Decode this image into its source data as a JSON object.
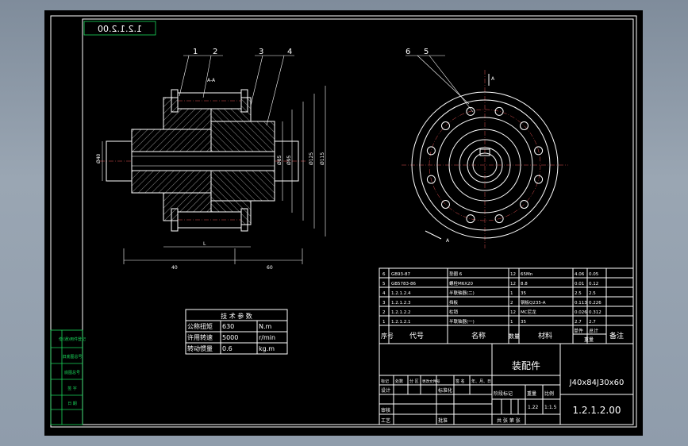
{
  "drawing_code_box": "1.2.1.2.00",
  "balloons": [
    "1",
    "2",
    "3",
    "4",
    "6",
    "5"
  ],
  "section_mark": "A-A",
  "side_view_mark": "A",
  "left_dims": [
    "Ø40",
    "40",
    "60",
    "L"
  ],
  "right_dims": [
    "Ø85",
    "Ø95",
    "Ø125",
    "Ø115"
  ],
  "tech_table": {
    "title": "技 术 参 数",
    "rows": [
      {
        "name": "公称扭矩",
        "value": "630",
        "unit": "N.m"
      },
      {
        "name": "许用转速",
        "value": "5000",
        "unit": "r/min"
      },
      {
        "name": "转动惯量",
        "value": "0.6",
        "unit": "kg.m"
      }
    ]
  },
  "bom": {
    "rows": [
      {
        "no": "6",
        "code": "GB93-87",
        "name": "垫圈 6",
        "qty": "12",
        "mat": "65Mn",
        "w1": "4.06",
        "w2": "0.05"
      },
      {
        "no": "5",
        "code": "GB5783-86",
        "name": "螺栓M6X20",
        "qty": "12",
        "mat": "8.8",
        "w1": "0.01",
        "w2": "0.12"
      },
      {
        "no": "4",
        "code": "1.2.1.2.4",
        "name": "半联轴器(二)",
        "qty": "1",
        "mat": "35",
        "w1": "2.5",
        "w2": "2.5"
      },
      {
        "no": "3",
        "code": "1.2.1.2.3",
        "name": "挡板",
        "qty": "2",
        "mat": "钢板Q235-A",
        "w1": "0.113",
        "w2": "0.226"
      },
      {
        "no": "2",
        "code": "1.2.1.2.2",
        "name": "柱销",
        "qty": "12",
        "mat": "MC尼龙",
        "w1": "0.026",
        "w2": "0.312"
      },
      {
        "no": "1",
        "code": "1.2.1.2.1",
        "name": "半联轴器(一)",
        "qty": "1",
        "mat": "35",
        "w1": "2.7",
        "w2": "2.7"
      }
    ],
    "headers": {
      "no": "序号",
      "code": "代号",
      "name": "名称",
      "qty": "数量",
      "mat": "材料",
      "single": "单件",
      "total": "总计",
      "weight": "重量",
      "remark": "备注"
    }
  },
  "title_block": {
    "assembly_label": "装配件",
    "part_name": "J40x84J30x60",
    "drawing_no": "1.2.1.2.00",
    "mark_row": [
      "标记",
      "处数",
      "分 区",
      "更改文件号",
      "签 名",
      "年、月、日"
    ],
    "design": "设计",
    "standardize": "标准化",
    "stage_row": [
      "阶段标记",
      "重量",
      "比例"
    ],
    "weight": "1.22",
    "scale": "1:1.5",
    "review": "审核",
    "process": "工艺",
    "approve": "批准",
    "sheet_info": "共 张 第 张"
  },
  "side_strip": [
    "借(通)用件登记",
    "旧底图总号",
    "底图总号",
    "签 字",
    "日 期"
  ]
}
